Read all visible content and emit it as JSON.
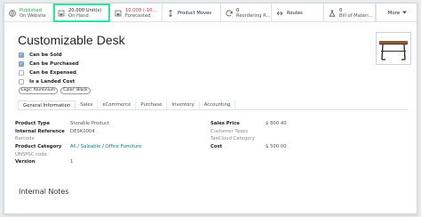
{
  "smart_buttons": [
    {
      "icon": "globe-icon",
      "value": "Published",
      "label": "On Website",
      "value_color": "#28a745"
    },
    {
      "icon": "boxes-icon",
      "value": "20.000 Unit(s)",
      "label": "On Hand"
    },
    {
      "icon": "boxes-icon",
      "value": "10.000 (-10....",
      "label": "Forecasted",
      "value_color": "#dc3545"
    },
    {
      "icon": "arrows-vertical-icon",
      "value": "Product Moves",
      "label": ""
    },
    {
      "icon": "refresh-icon",
      "value": "0",
      "label": "Reordering R..."
    },
    {
      "icon": "routes-icon",
      "value": "Routes",
      "label": ""
    },
    {
      "icon": "flask-icon",
      "value": "0",
      "label": "Bill of Materi..."
    }
  ],
  "more_label": "More",
  "product": {
    "name": "Customizable Desk",
    "flags": [
      {
        "label": "Can be Sold",
        "checked": true
      },
      {
        "label": "Can be Purchased",
        "checked": true
      },
      {
        "label": "Can be Expensed",
        "checked": false
      },
      {
        "label": "Is a Landed Cost",
        "checked": false
      }
    ],
    "tags": [
      "Legs: Aluminium",
      "Color: Black"
    ]
  },
  "tabs": [
    "General Information",
    "Sales",
    "eCommerce",
    "Purchase",
    "Inventory",
    "Accounting"
  ],
  "left_fields": [
    {
      "label": "Product Type",
      "value": "Storable Product"
    },
    {
      "label": "Internal Reference",
      "value": "DESK0004"
    },
    {
      "label": "Barcode",
      "value": "",
      "muted": true
    },
    {
      "label": "Product Category",
      "value": "All / Saleable / Office Furniture",
      "link": true
    },
    {
      "label": "UNSPSC code",
      "value": "",
      "muted": true
    },
    {
      "label": "Version",
      "value": "1"
    }
  ],
  "right_fields": [
    {
      "label": "Sales Price",
      "value": "$ 800.40"
    },
    {
      "label": "Customer Taxes",
      "value": "",
      "muted": true
    },
    {
      "label": "TaxCloud Category",
      "value": "",
      "muted": true
    },
    {
      "label": "Cost",
      "value": "$ 500.00"
    }
  ],
  "internal_notes_label": "Internal Notes",
  "accent": "#2ee59d"
}
